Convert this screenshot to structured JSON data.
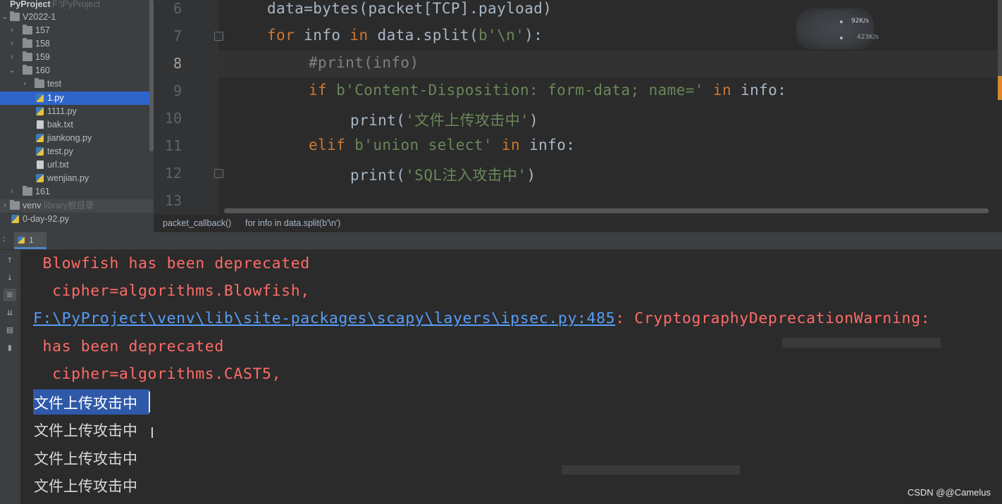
{
  "project_tree": {
    "root": {
      "label": "PyProject",
      "path": "F:\\PyProject"
    },
    "items": [
      {
        "label": "V2022-1"
      },
      {
        "label": "157"
      },
      {
        "label": "158"
      },
      {
        "label": "159"
      },
      {
        "label": "160"
      },
      {
        "label": "test"
      },
      {
        "label": "1.py"
      },
      {
        "label": "1111.py"
      },
      {
        "label": "bak.txt"
      },
      {
        "label": "jiankong.py"
      },
      {
        "label": "test.py"
      },
      {
        "label": "url.txt"
      },
      {
        "label": "wenjian.py"
      },
      {
        "label": "161"
      },
      {
        "label": "venv",
        "suffix": "library根目录"
      },
      {
        "label": "0-day-92.py"
      }
    ]
  },
  "editor": {
    "line_numbers": [
      "6",
      "7",
      "8",
      "9",
      "10",
      "11",
      "12",
      "13"
    ],
    "current_line": "8",
    "lines": {
      "l6": "data=bytes(packet[TCP].payload)",
      "l7_kw": "for",
      "l7_a": " info ",
      "l7_in": "in",
      "l7_b": " data.split(",
      "l7_str": "b'\\n'",
      "l7_c": "):",
      "l8": "#print(info)",
      "l9_kw": "if",
      "l9_str": " b'Content-Disposition: form-data; name='",
      "l9_in": " in",
      "l9_b": " info:",
      "l10_a": "print(",
      "l10_str": "'文件上传攻击中'",
      "l10_b": ")",
      "l11_kw": "elif",
      "l11_str": " b'union select'",
      "l11_in": " in",
      "l11_b": " info:",
      "l12_a": "print(",
      "l12_str": "'SQL注入攻击中'",
      "l12_b": ")"
    }
  },
  "overlay": {
    "top": "92K/s",
    "bottom": "423K/s"
  },
  "breadcrumb": [
    "packet_callback()",
    "for info in data.split(b'\\n')"
  ],
  "run_panel": {
    "tab_label": "1",
    "console": {
      "l1": " Blowfish has been deprecated",
      "l2": "  cipher=algorithms.Blowfish,",
      "l3_link": "F:\\PyProject\\venv\\lib\\site-packages\\scapy\\layers\\ipsec.py:485",
      "l3_rest": ": CryptographyDeprecationWarning:",
      "l4": " has been deprecated",
      "l5": "  cipher=algorithms.CAST5,",
      "outputs": [
        "文件上传攻击中",
        "文件上传攻击中",
        "文件上传攻击中",
        "文件上传攻击中"
      ]
    }
  },
  "watermark": "CSDN @@Camelus",
  "colors": {
    "keyword": "#cc7832",
    "string": "#6a8759",
    "comment": "#808080",
    "error": "#ff6b68",
    "link": "#589df6",
    "selection": "#2f59a8"
  }
}
